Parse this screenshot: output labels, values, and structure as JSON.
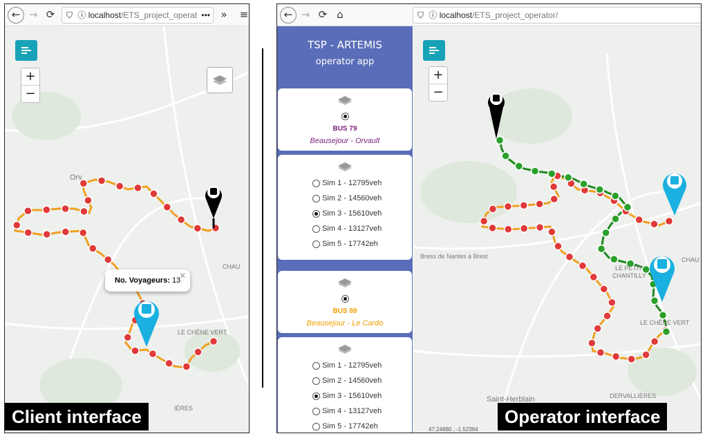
{
  "client": {
    "url_host": "localhost",
    "url_path": "/ETS_project_operat",
    "popup_label": "No. Voyageurs:",
    "popup_value": "13",
    "map_labels": [
      "Orv",
      "CHAU",
      "LE CHÊNE VERT",
      "IÈRES"
    ],
    "caption": "Client interface"
  },
  "operator": {
    "url_host": "localhost",
    "url_path": "/ETS_project_operator/",
    "sidebar_title": "TSP - ARTEMIS",
    "sidebar_subtitle": "operator app",
    "bus79": {
      "name": "BUS 79",
      "route": "Beausejour - Orvault",
      "color": "#7b1f7b"
    },
    "bus89": {
      "name": "BUS 89",
      "route": "Beausejour - Le Cardo",
      "color": "#f0a000"
    },
    "sims_a": [
      "Sim 1 - 12795veh",
      "Sim 2 - 14560veh",
      "Sim 3 - 15610veh",
      "Sim 4 - 13127veh",
      "Sim 5 - 17742eh"
    ],
    "sims_b": [
      "Sim 1 - 12795veh",
      "Sim 2 - 14560veh",
      "Sim 3 - 15610veh",
      "Sim 4 - 13127veh",
      "Sim 5 - 17742eh"
    ],
    "selected_sim": 2,
    "map_labels": [
      "Bress de Nantes à Brest",
      "LE PETIT",
      "CHANTILLY",
      "CHAU",
      "LE CHÊNE VERT",
      "Saint-Herblain",
      "DERVALLIÈRES"
    ],
    "coords": "47.24880 , -1.52364",
    "caption": "Operator interface"
  },
  "colors": {
    "accent": "#17a2b8",
    "route_orange": "#f0a020",
    "route_green": "#1e8a1e",
    "stop_red": "#e03a3a",
    "stop_green": "#2aa02a",
    "sidebar": "#5a6db8"
  }
}
